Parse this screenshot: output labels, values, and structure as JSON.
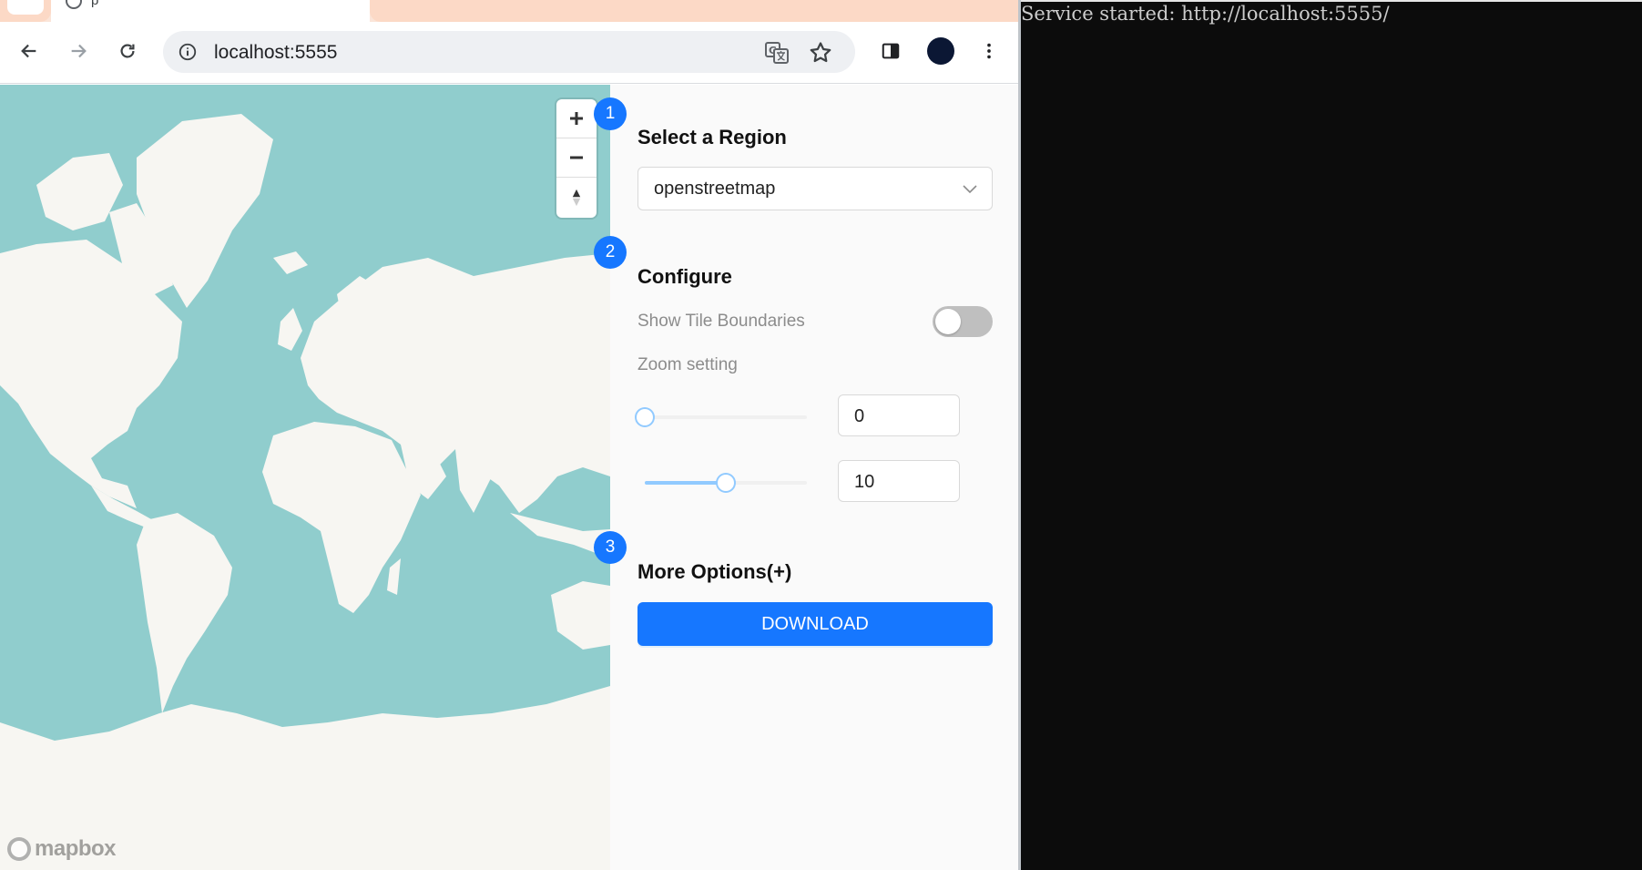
{
  "browser": {
    "tab_title_fragment": "p",
    "url": "localhost:5555"
  },
  "panel": {
    "steps": [
      "1",
      "2",
      "3"
    ],
    "select_region_title": "Select a Region",
    "region_value": "openstreetmap",
    "configure_title": "Configure",
    "show_tile_boundaries_label": "Show Tile Boundaries",
    "show_tile_boundaries_on": false,
    "zoom_setting_label": "Zoom setting",
    "zoom_min": "0",
    "zoom_max": "10",
    "zoom_min_fraction": 0.0,
    "zoom_max_fraction": 0.5,
    "more_options_title": "More Options(+)",
    "download_label": "DOWNLOAD"
  },
  "map": {
    "attribution_logo": "mapbox",
    "water_color": "#90cdcd",
    "land_color": "#f7f6f2"
  },
  "terminal": {
    "output": "Service started: http://localhost:5555/"
  },
  "colors": {
    "accent": "#1677ff",
    "terminal_bg": "#0c0c0c"
  }
}
